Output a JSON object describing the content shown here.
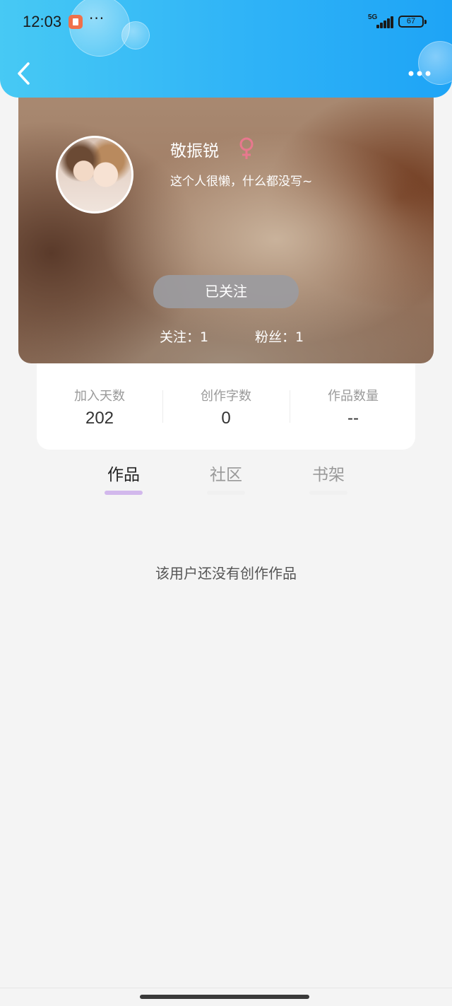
{
  "status_bar": {
    "time": "12:03",
    "dots": "···",
    "network": "5G",
    "battery": "67"
  },
  "profile": {
    "username": "敬振锐",
    "gender_icon": "female-icon",
    "bio": "这个人很懒，什么都没写~",
    "follow_button_label": "已关注",
    "following_label": "关注：1",
    "followers_label": "粉丝：1"
  },
  "stats": [
    {
      "label": "加入天数",
      "value": "202"
    },
    {
      "label": "创作字数",
      "value": "0"
    },
    {
      "label": "作品数量",
      "value": "--"
    }
  ],
  "tabs": [
    {
      "label": "作品",
      "active": true
    },
    {
      "label": "社区",
      "active": false
    },
    {
      "label": "书架",
      "active": false
    }
  ],
  "empty_message": "该用户还没有创作作品",
  "colors": {
    "header_start": "#47c9f4",
    "header_end": "#1ea4f6",
    "tab_active_underline": "#d2b8ec",
    "tab_inactive_underline": "#f0f0f0",
    "female_icon": "#e8788e"
  }
}
